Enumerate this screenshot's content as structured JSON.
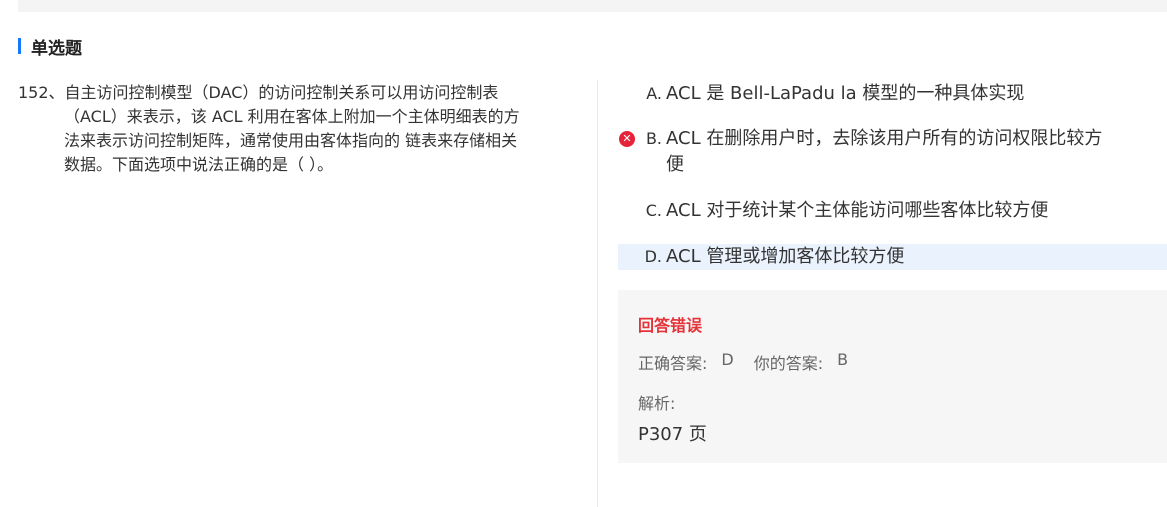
{
  "section": {
    "title": "单选题"
  },
  "question": {
    "number": "152、",
    "line1": "自主访问控制模型（DAC）的访问控制关系可以用访问控制表",
    "line2": "（ACL）来表示，该 ACL 利用在客体上附加一个主体明细表的方",
    "line3": "法来表示访问控制矩阵，通常使用由客体指向的 链表来存储相关",
    "line4": "数据。下面选项中说法正确的是（ ）。"
  },
  "options": [
    {
      "letter": "A.",
      "text": "ACL 是 Bell-LaPadu la 模型的一种具体实现"
    },
    {
      "letter": "B.",
      "line1": "ACL 在删除用户时，去除该用户所有的访问权限比较方",
      "line2": "便",
      "status": "wrong",
      "mark_icon": "close-circle-icon"
    },
    {
      "letter": "C.",
      "text": "ACL 对于统计某个主体能访问哪些客体比较方便"
    },
    {
      "letter": "D.",
      "text": "ACL 管理或增加客体比较方便",
      "status": "correct-highlight"
    }
  ],
  "result": {
    "status": "回答错误",
    "correct_label": "正确答案:",
    "correct_value": "D",
    "your_label": "你的答案:",
    "your_value": "B",
    "analysis_label": "解析:",
    "analysis_text": "P307 页"
  },
  "colors": {
    "accent": "#1677ff",
    "error": "#e5233a",
    "highlight": "#e9f2fd",
    "panel": "#f6f6f6"
  }
}
